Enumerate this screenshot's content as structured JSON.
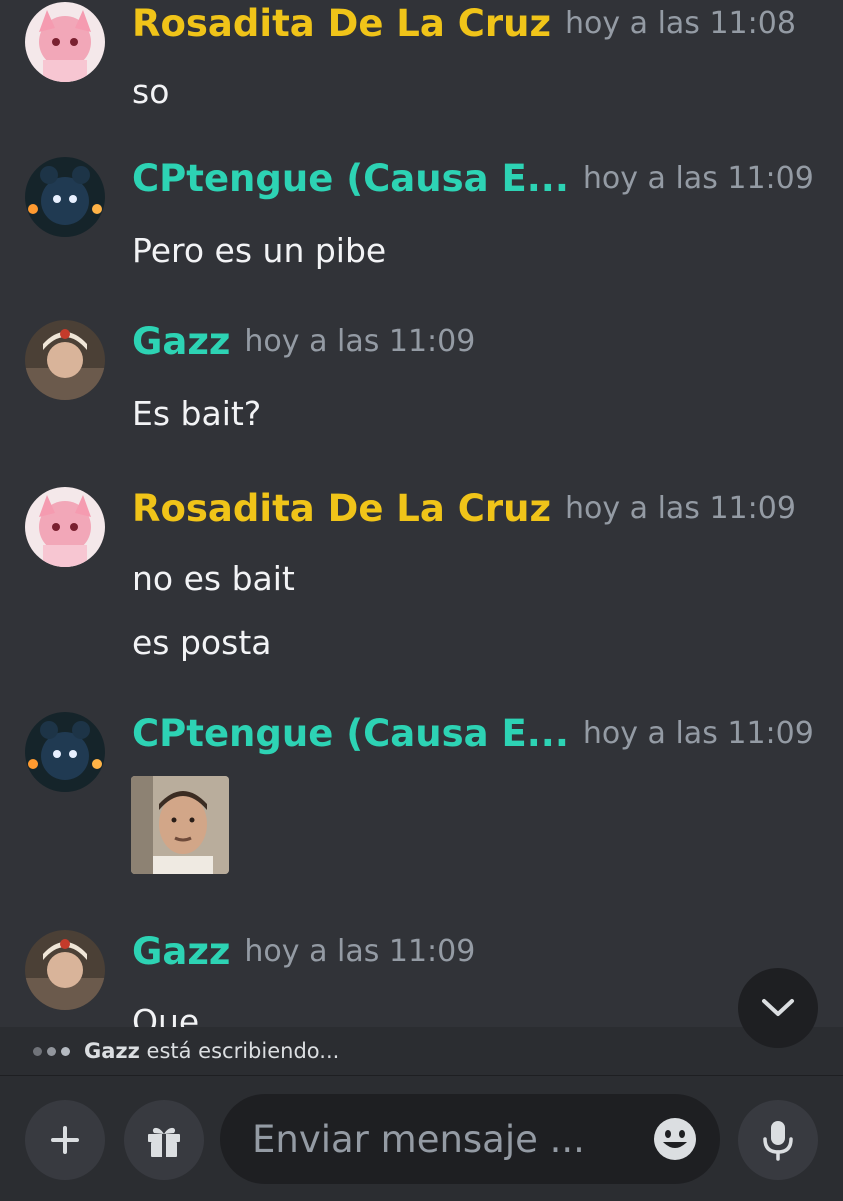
{
  "messages": [
    {
      "author": "Rosadita De La Cruz",
      "author_color": "#f0c419",
      "time": "hoy a las 11:08",
      "avatar": "pink-anime-avatar",
      "lines": [
        "so"
      ]
    },
    {
      "author": "CPtengue (Causa E...",
      "author_color": "#2dd3b4",
      "time": "hoy a las 11:09",
      "avatar": "animatronic-bear-avatar",
      "lines": [
        "Pero es un pibe"
      ]
    },
    {
      "author": "Gazz",
      "author_color": "#2dd3b4",
      "time": "hoy a las 11:09",
      "avatar": "photo-avatar",
      "lines": [
        "Es bait?"
      ]
    },
    {
      "author": "Rosadita De La Cruz",
      "author_color": "#f0c419",
      "time": "hoy a las 11:09",
      "avatar": "pink-anime-avatar",
      "lines": [
        "no es bait",
        "es posta"
      ]
    },
    {
      "author": "CPtengue (Causa E...",
      "author_color": "#2dd3b4",
      "time": "hoy a las 11:09",
      "avatar": "animatronic-bear-avatar",
      "lines": [],
      "attachment": "selfie-photo"
    },
    {
      "author": "Gazz",
      "author_color": "#2dd3b4",
      "time": "hoy a las 11:09",
      "avatar": "photo-avatar",
      "lines": [
        "Que"
      ]
    }
  ],
  "typing": {
    "user": "Gazz",
    "text": "está escribiendo..."
  },
  "composer": {
    "placeholder": "Enviar mensaje ...",
    "value": ""
  },
  "icons": {
    "add": "plus-icon",
    "gift": "gift-icon",
    "emoji": "emoji-icon",
    "mic": "microphone-icon",
    "scroll": "chevron-down-icon"
  }
}
